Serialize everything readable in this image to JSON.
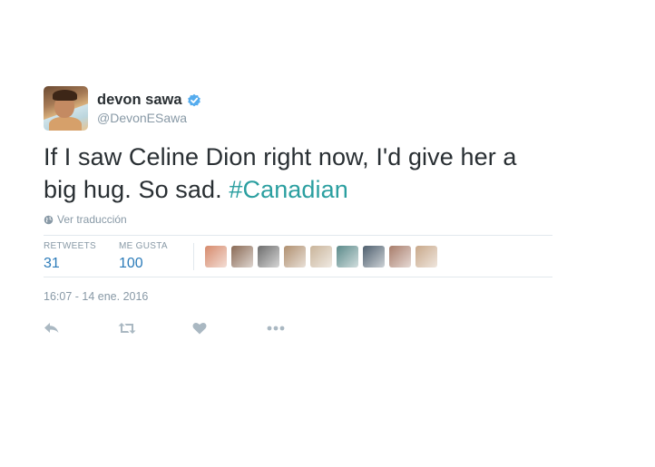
{
  "user": {
    "display_name": "devon sawa",
    "handle": "@DevonESawa",
    "verified": true,
    "avatar_icon": "profile-photo"
  },
  "tweet": {
    "text_before": "If I saw Celine Dion right now, I'd give her a big hug.  So sad. ",
    "hashtag": "#Canadian",
    "translate_label": "Ver traducción",
    "timestamp": "16:07 - 14 ene. 2016"
  },
  "stats": {
    "retweets_label": "RETWEETS",
    "retweets_count": "31",
    "likes_label": "ME GUSTA",
    "likes_count": "100"
  },
  "likers": [
    {
      "color": "#d68a6c"
    },
    {
      "color": "#8a6a55"
    },
    {
      "color": "#6d6d6d"
    },
    {
      "color": "#b09070"
    },
    {
      "color": "#c9b49a"
    },
    {
      "color": "#5b8a8a"
    },
    {
      "color": "#4e5f6e"
    },
    {
      "color": "#a87c6a"
    },
    {
      "color": "#c8a88a"
    }
  ],
  "actions": {
    "reply_icon": "reply-icon",
    "retweet_icon": "retweet-icon",
    "like_icon": "heart-icon",
    "more_icon": "more-icon"
  },
  "colors": {
    "hashtag": "#2b9fa0",
    "count": "#2b7bb9",
    "muted": "#8899a6",
    "text": "#292f33",
    "border": "#e1e8ed"
  }
}
